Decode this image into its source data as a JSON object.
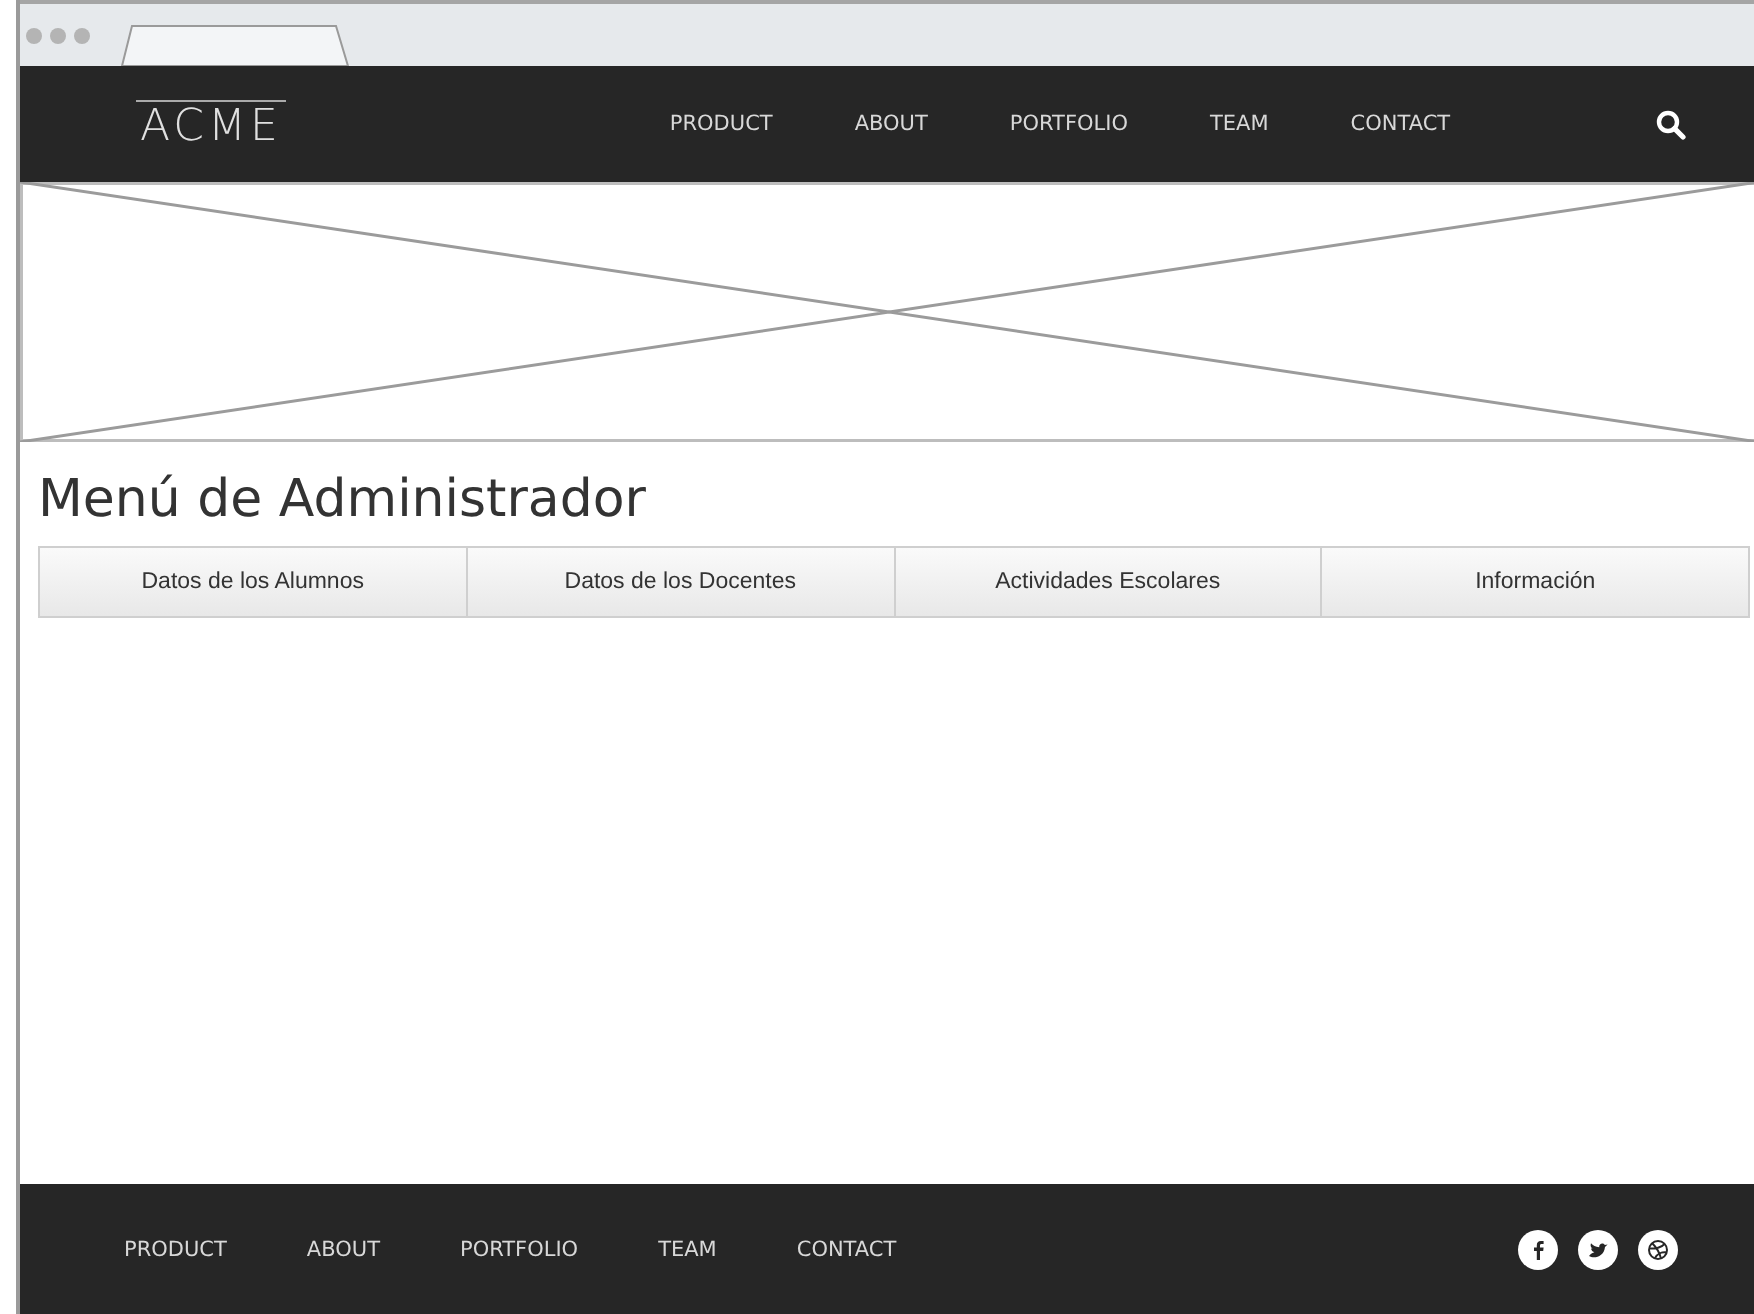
{
  "header": {
    "logo": "ACME",
    "nav": [
      "PRODUCT",
      "ABOUT",
      "PORTFOLIO",
      "TEAM",
      "CONTACT"
    ]
  },
  "hero": {
    "kind": "placeholder"
  },
  "page_title": "Menú de Administrador",
  "menu_buttons": [
    "Datos de los Alumnos",
    "Datos de los Docentes",
    "Actividades Escolares",
    "Información"
  ],
  "footer": {
    "nav": [
      "PRODUCT",
      "ABOUT",
      "PORTFOLIO",
      "TEAM",
      "CONTACT"
    ]
  }
}
